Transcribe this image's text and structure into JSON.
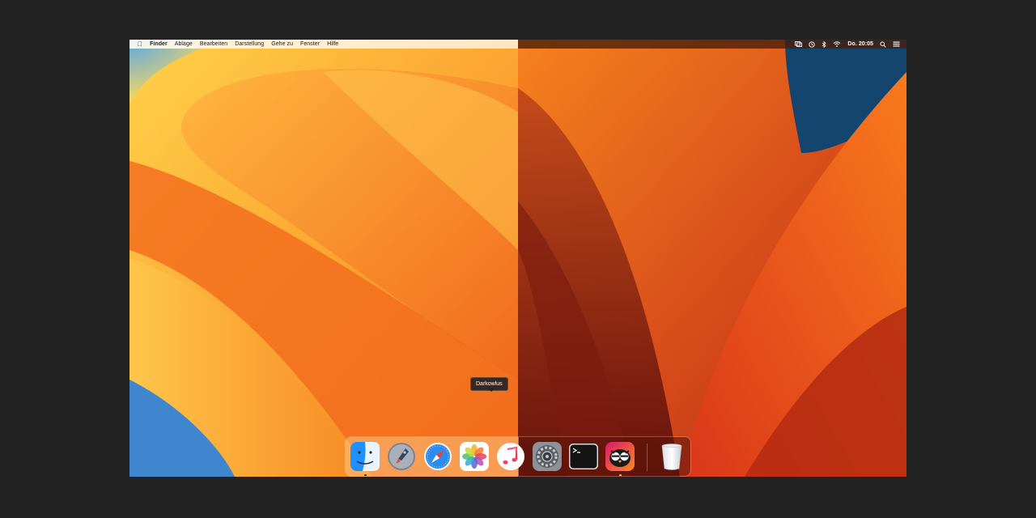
{
  "menubar": {
    "apple_icon": "apple-logo",
    "app_name": "Finder",
    "menus": [
      "Ablage",
      "Bearbeiten",
      "Darstellung",
      "Gehe zu",
      "Fenster",
      "Hilfe"
    ],
    "status_icons": [
      "screen-mirroring-icon",
      "time-machine-icon",
      "bluetooth-icon",
      "wifi-icon"
    ],
    "clock": "Do. 20:05",
    "right_icons": [
      "spotlight-search-icon",
      "control-center-icon"
    ]
  },
  "dock": {
    "apps": [
      {
        "name": "Finder",
        "icon": "finder-icon",
        "running": true
      },
      {
        "name": "Launchpad",
        "icon": "launchpad-icon",
        "running": false
      },
      {
        "name": "Safari",
        "icon": "safari-icon",
        "running": false
      },
      {
        "name": "Fotos",
        "icon": "photos-icon",
        "running": false
      },
      {
        "name": "Musik",
        "icon": "music-icon",
        "running": false
      },
      {
        "name": "Systemeinstellungen",
        "icon": "system-preferences-icon",
        "running": false
      },
      {
        "name": "Terminal",
        "icon": "terminal-icon",
        "running": false
      },
      {
        "name": "Darkowlus",
        "icon": "darkowlus-owl-icon",
        "running": true
      }
    ],
    "trash": {
      "name": "Papierkorb",
      "icon": "trash-icon"
    },
    "tooltip": "Darkowlus"
  },
  "colors": {
    "light_wallpaper": "#f7a532",
    "dark_wallpaper": "#c8441a",
    "background": "#222222"
  }
}
